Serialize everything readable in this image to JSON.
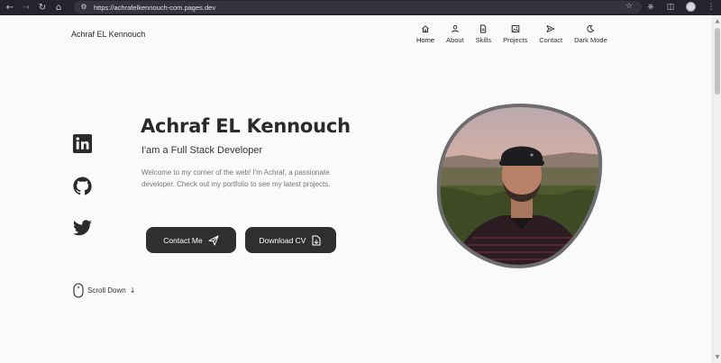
{
  "browser": {
    "url": "https://achrafelkennouch-com.pages.dev"
  },
  "header": {
    "brand": "Achraf EL Kennouch",
    "menu": [
      {
        "label": "Home",
        "icon": "home-icon"
      },
      {
        "label": "About",
        "icon": "user-icon"
      },
      {
        "label": "Skills",
        "icon": "document-icon"
      },
      {
        "label": "Projects",
        "icon": "image-icon"
      },
      {
        "label": "Contact",
        "icon": "send-icon"
      },
      {
        "label": "Dark Mode",
        "icon": "moon-icon"
      }
    ]
  },
  "social": [
    {
      "name": "linkedin-icon"
    },
    {
      "name": "github-icon"
    },
    {
      "name": "twitter-icon"
    }
  ],
  "hero": {
    "title": "Achraf EL Kennouch",
    "subtitle": "I'am a Full Stack Developer",
    "description": "Welcome to my corner of the web! I'm Achraf, a passionate developer. Check out my portfolio to see my latest projects.",
    "contact_label": "Contact Me",
    "cv_label": "Download CV",
    "scroll_label": "Scroll Down"
  },
  "colors": {
    "background": "#fafafa",
    "button": "#2f2f2f",
    "chrome": "#25232f"
  }
}
